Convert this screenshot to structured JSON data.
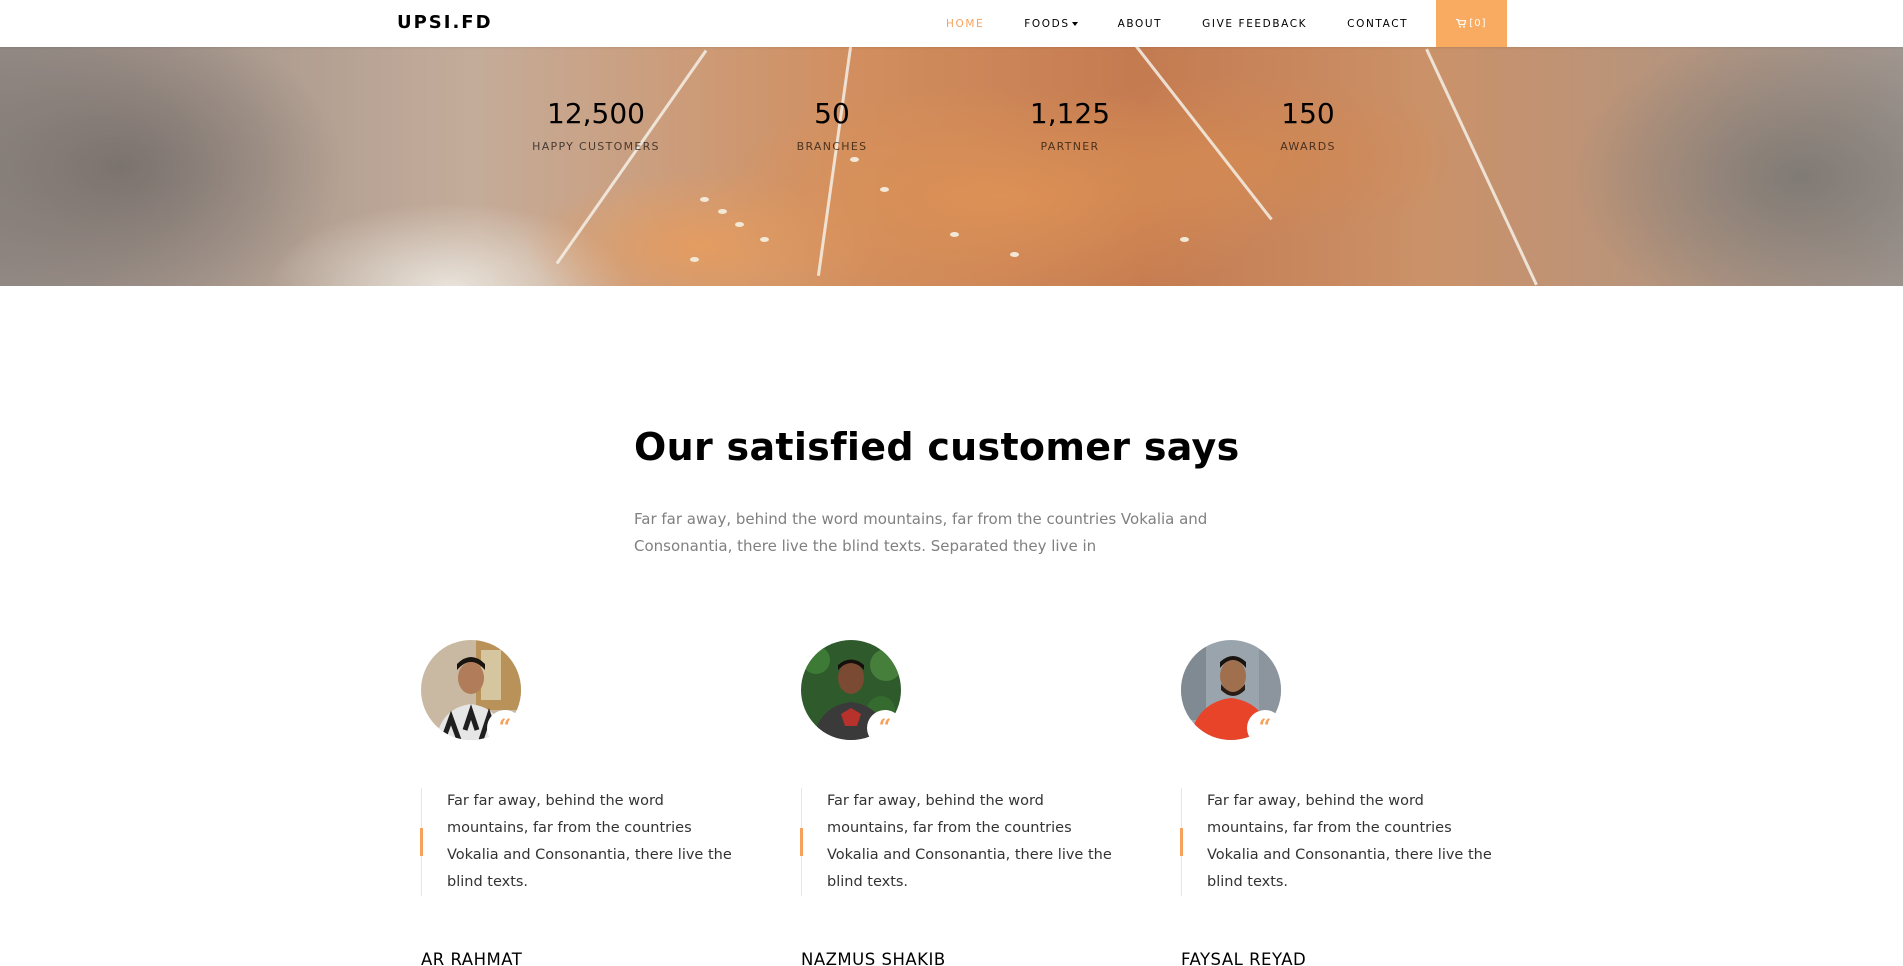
{
  "brand": "UPSI.FD",
  "nav": {
    "items": [
      {
        "label": "HOME",
        "active": true
      },
      {
        "label": "FOODS",
        "dropdown": true
      },
      {
        "label": "ABOUT"
      },
      {
        "label": "GIVE FEEDBACK"
      },
      {
        "label": "CONTACT"
      }
    ],
    "cart_label": "[0]",
    "cart_icon": "cart-icon",
    "accent_color": "#f7a25c"
  },
  "stats": [
    {
      "value": "12,500",
      "label": "HAPPY CUSTOMERS"
    },
    {
      "value": "50",
      "label": "BRANCHES"
    },
    {
      "value": "1,125",
      "label": "PARTNER"
    },
    {
      "value": "150",
      "label": "AWARDS"
    }
  ],
  "testimonials": {
    "title": "Our satisfied customer says",
    "subtitle": "Far far away, behind the word mountains, far from the countries Vokalia and Consonantia, there live the blind texts. Separated they live in",
    "quote_icon": "quote-icon",
    "items": [
      {
        "text": "Far far away, behind the word mountains, far from the countries Vokalia and Consonantia, there live the blind texts.",
        "author": "AR RAHMAT"
      },
      {
        "text": "Far far away, behind the word mountains, far from the countries Vokalia and Consonantia, there live the blind texts.",
        "author": "NAZMUS SHAKIB"
      },
      {
        "text": "Far far away, behind the word mountains, far from the countries Vokalia and Consonantia, there live the blind texts.",
        "author": "FAYSAL REYAD"
      }
    ]
  }
}
